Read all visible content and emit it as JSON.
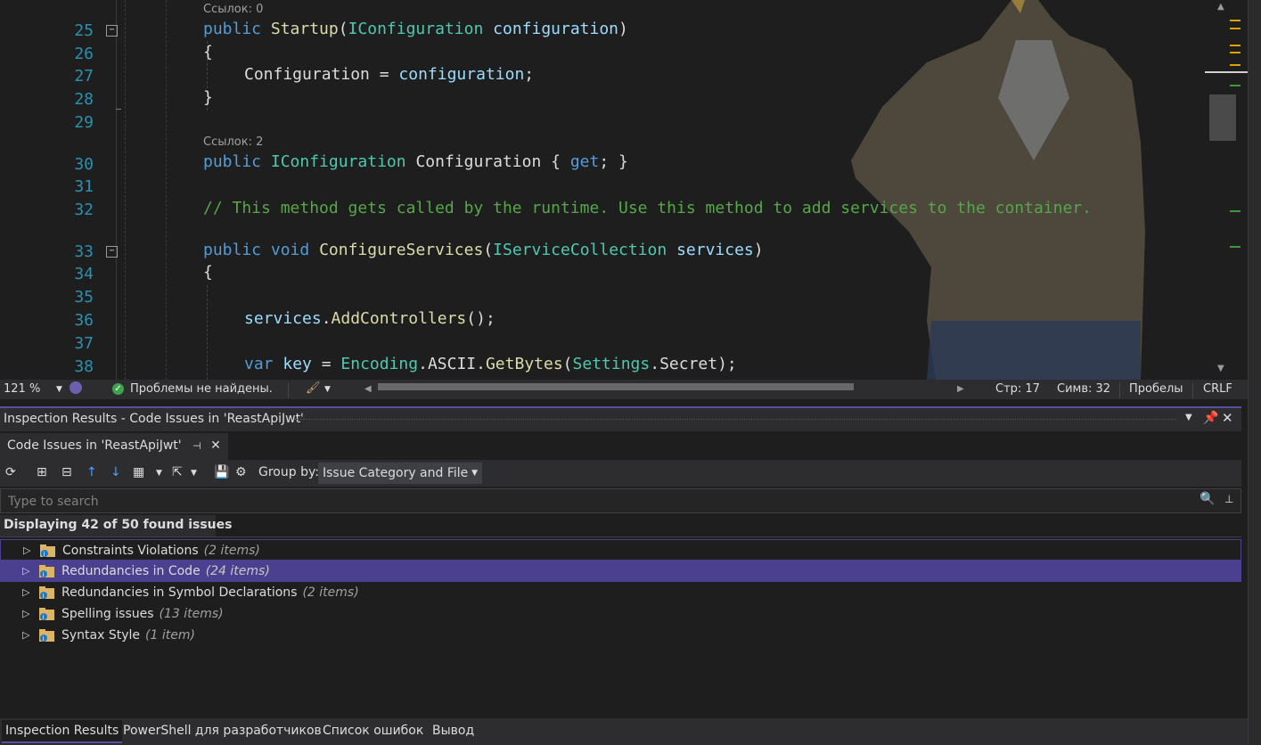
{
  "editor": {
    "lines": [
      {
        "num": "25"
      },
      {
        "num": "26"
      },
      {
        "num": "27"
      },
      {
        "num": "28"
      },
      {
        "num": "29"
      },
      {
        "num": "30"
      },
      {
        "num": "31"
      },
      {
        "num": "32"
      },
      {
        "num": "33"
      },
      {
        "num": "34"
      },
      {
        "num": "35"
      },
      {
        "num": "36"
      },
      {
        "num": "37"
      },
      {
        "num": "38"
      }
    ],
    "codelens": [
      "Ссылок: 0",
      "Ссылок: 2"
    ],
    "tokens": {
      "public": "public",
      "Startup": "Startup",
      "IConfiguration": "IConfiguration",
      "configuration": "configuration",
      "lparen": "(",
      "rparen": ")",
      "space": " ",
      "open_brace": "{",
      "close_brace": "}",
      "Configuration": "Configuration",
      "assign": " = ",
      "semicolon": ";",
      "prop_body_open": " { ",
      "get": "get",
      "prop_body_close": "; }",
      "comment": "// This method gets called by the runtime. Use this method to add services to the container.",
      "void": "void",
      "ConfigureServices": "ConfigureServices",
      "IServiceCollection": "IServiceCollection",
      "services": "services",
      "dot": ".",
      "AddControllers": "AddControllers",
      "call_end": "();",
      "var": "var",
      "key": "key",
      "Encoding": "Encoding",
      "ASCII": "ASCII",
      "GetBytes": "GetBytes",
      "Settings": "Settings",
      "Secret": "Secret",
      "stmt_end": ");"
    }
  },
  "status_bar": {
    "zoom": "121 %",
    "no_issues": "Проблемы не найдены.",
    "line": "Стр: 17",
    "col": "Симв: 32",
    "whitespace": "Пробелы",
    "eol": "CRLF"
  },
  "tool_window": {
    "title": "Inspection Results - Code Issues in 'ReastApiJwt'",
    "tab_label": "Code Issues in 'ReastApiJwt'",
    "group_by_label": "Group by:",
    "group_by_value": "Issue Category and File",
    "search_placeholder": "Type to search",
    "summary": "Displaying 42 of 50 found issues",
    "items": [
      {
        "label": "Constraints Violations",
        "count": "(2 items)"
      },
      {
        "label": "Redundancies in Code",
        "count": "(24 items)"
      },
      {
        "label": "Redundancies in Symbol Declarations",
        "count": "(2 items)"
      },
      {
        "label": "Spelling issues",
        "count": "(13 items)"
      },
      {
        "label": "Syntax Style",
        "count": "(1 item)"
      }
    ]
  },
  "bottom_tabs": [
    "Inspection Results",
    "PowerShell для разработчиков",
    "Список ошибок",
    "Вывод"
  ],
  "colors": {
    "accent": "#5a4fa0",
    "selection": "#4b3f8f",
    "keyword": "#569cd6",
    "type": "#4ec9b0",
    "comment": "#57a64a"
  }
}
